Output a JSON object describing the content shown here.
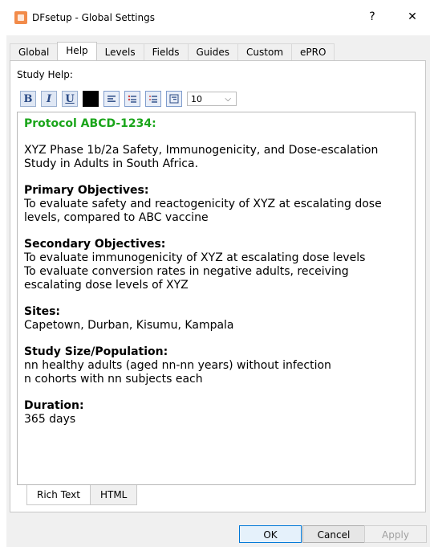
{
  "window": {
    "title": "DFsetup - Global Settings",
    "help_glyph": "?",
    "close_glyph": "✕"
  },
  "tabs": [
    "Global",
    "Help",
    "Levels",
    "Fields",
    "Guides",
    "Custom",
    "ePRO"
  ],
  "active_tab": "Help",
  "study_help_label": "Study Help:",
  "toolbar": {
    "bold": "B",
    "italic": "I",
    "underline": "U",
    "font_size": "10",
    "icons": [
      "bold-icon",
      "italic-icon",
      "underline-icon",
      "color-swatch-icon",
      "align-icon",
      "bullet-list-icon",
      "numbered-list-icon",
      "indent-icon"
    ]
  },
  "content": {
    "protocol": "Protocol ABCD-1234:",
    "description": "XYZ Phase 1b/2a Safety, Immunogenicity, and Dose-escalation Study in Adults in South Africa.",
    "primary_heading": "Primary Objectives:",
    "primary_1": "To evaluate safety and reactogenicity of XYZ at escalating dose levels, compared to ABC vaccine",
    "secondary_heading": "Secondary Objectives:",
    "secondary_1": "To evaluate immunogenicity of XYZ at escalating dose levels",
    "secondary_2": "To evaluate conversion rates in negative adults, receiving escalating dose levels of XYZ",
    "sites_heading": "Sites:",
    "sites": "Capetown, Durban, Kisumu, Kampala",
    "size_heading": "Study Size/Population:",
    "size_1": "nn healthy adults (aged nn-nn years) without infection",
    "size_2": "n cohorts with nn subjects each",
    "duration_heading": "Duration:",
    "duration": "365 days"
  },
  "bottom_tabs": [
    "Rich Text",
    "HTML"
  ],
  "buttons": {
    "ok": "OK",
    "cancel": "Cancel",
    "apply": "Apply"
  },
  "colors": {
    "protocol_green": "#1aa51a",
    "accent_blue": "#0078d7"
  }
}
